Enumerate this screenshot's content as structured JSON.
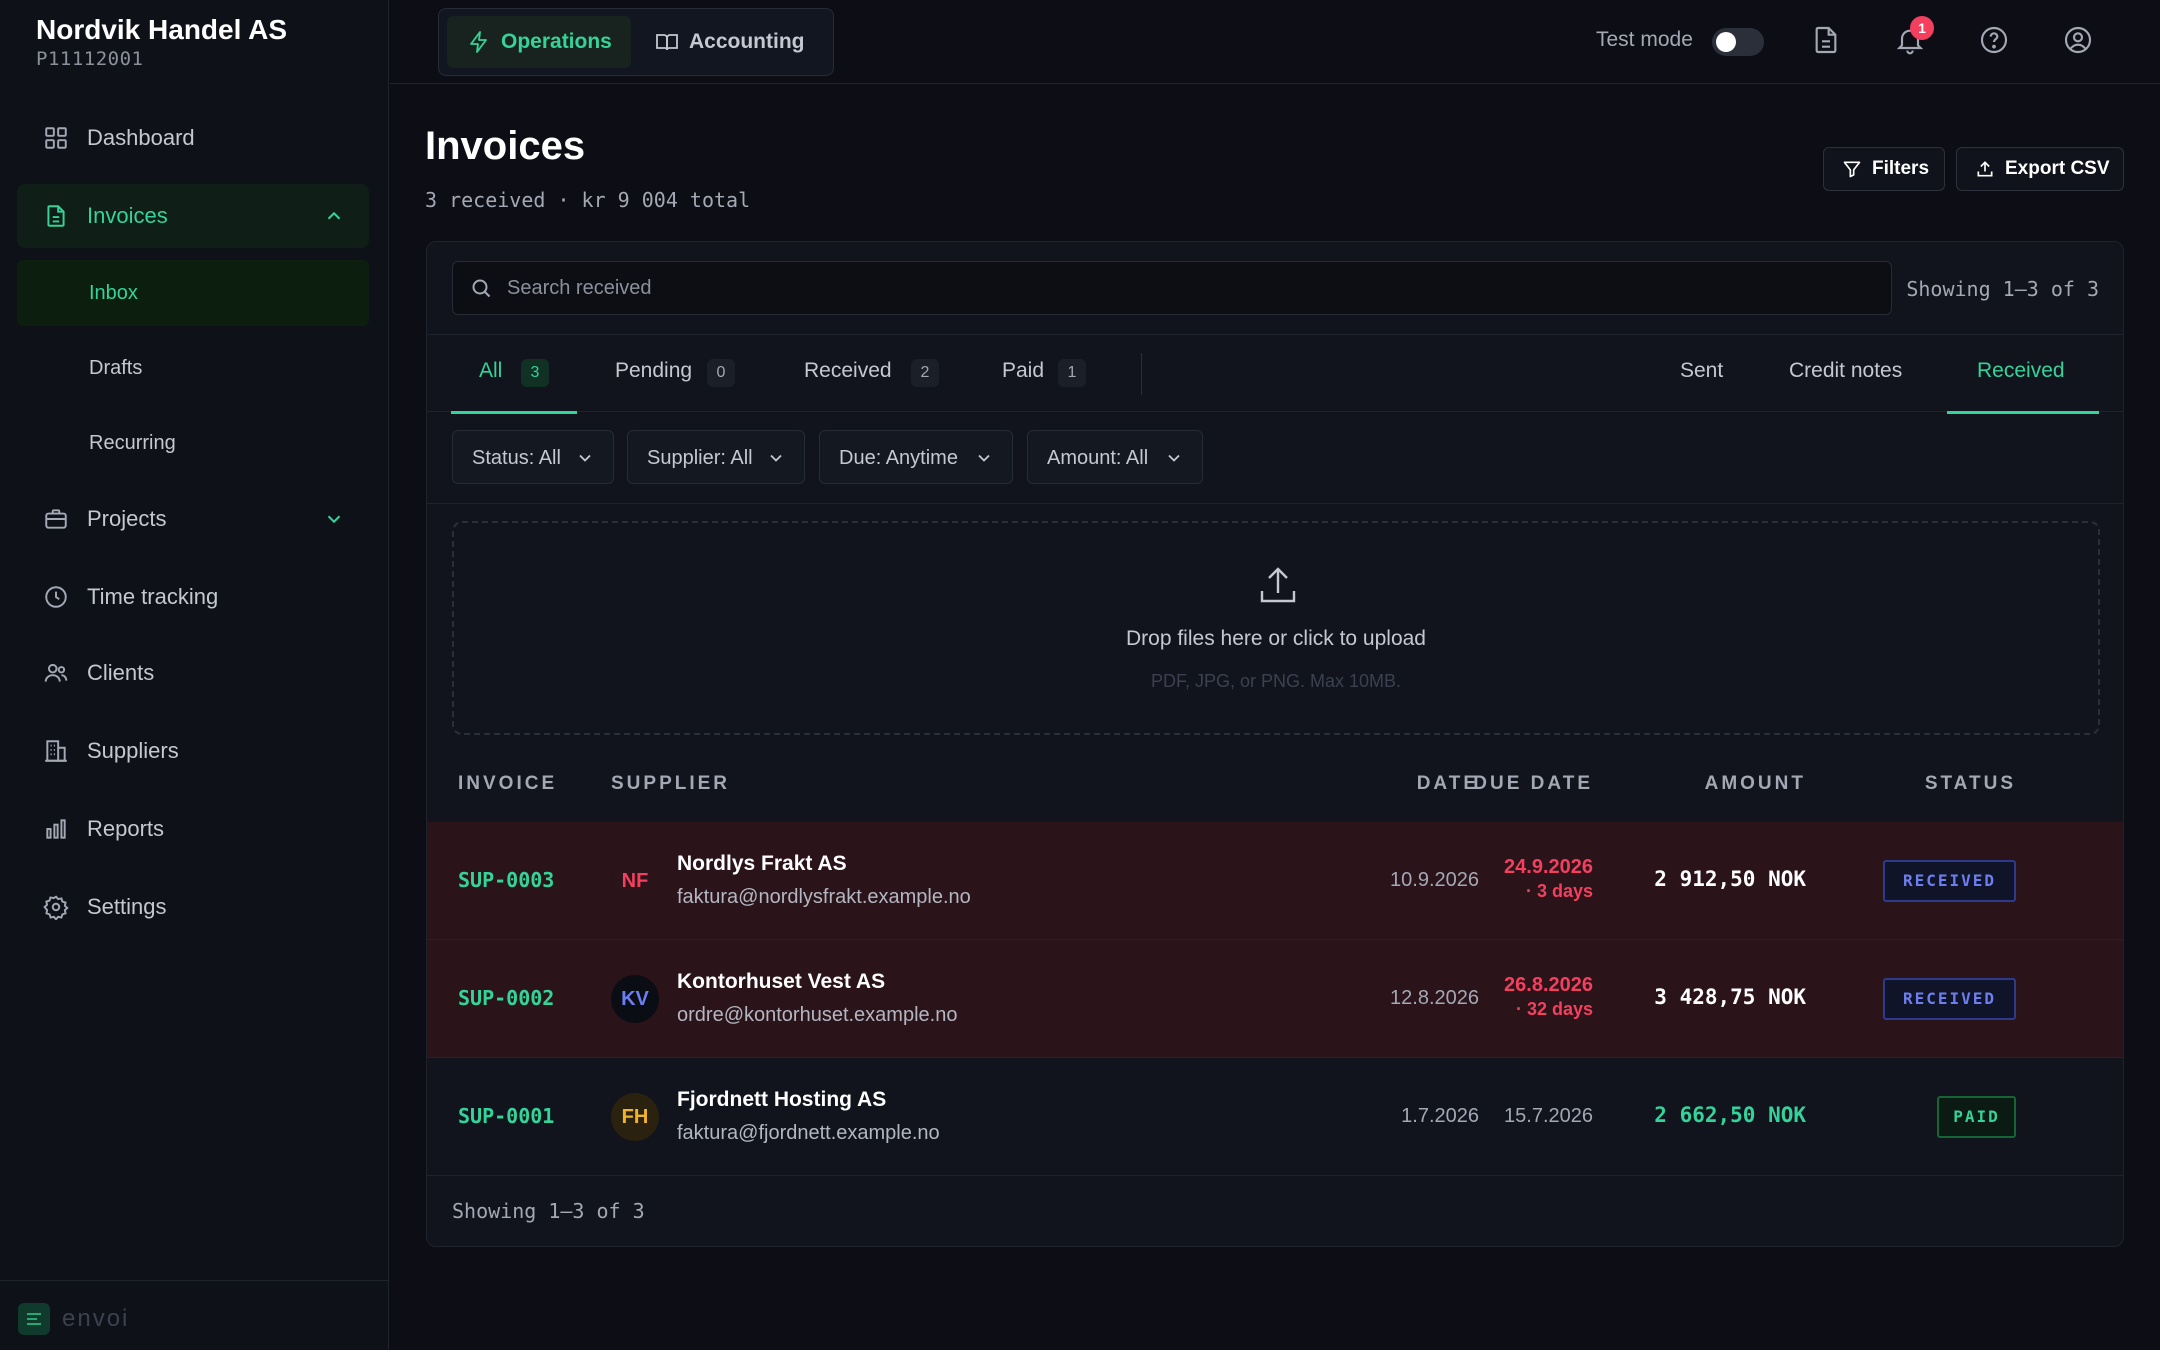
{
  "org": {
    "name": "Nordvik Handel AS",
    "id": "P11112001"
  },
  "nav": {
    "dashboard": "Dashboard",
    "invoices": "Invoices",
    "inbox": "Inbox",
    "drafts": "Drafts",
    "recurring": "Recurring",
    "projects": "Projects",
    "time_tracking": "Time tracking",
    "clients": "Clients",
    "suppliers": "Suppliers",
    "reports": "Reports",
    "settings": "Settings"
  },
  "brand": "envoi",
  "topbar": {
    "operations": "Operations",
    "accounting": "Accounting",
    "test_mode": "Test mode",
    "notification_count": "1"
  },
  "page": {
    "title": "Invoices",
    "subtitle": "3 received · kr 9 004 total",
    "filters_btn": "Filters",
    "export_btn": "Export CSV"
  },
  "search": {
    "placeholder": "Search received",
    "showing": "Showing 1–3 of 3"
  },
  "tabs": {
    "all": "All",
    "all_count": "3",
    "pending": "Pending",
    "pending_count": "0",
    "received": "Received",
    "received_count": "2",
    "paid": "Paid",
    "paid_count": "1",
    "sent": "Sent",
    "credit_notes": "Credit notes",
    "received_view": "Received"
  },
  "filters": {
    "status": "Status: All",
    "supplier": "Supplier: All",
    "due": "Due: Anytime",
    "amount": "Amount: All"
  },
  "upload": {
    "title": "Drop files here or click to upload",
    "hint": "PDF, JPG, or PNG. Max 10MB."
  },
  "table": {
    "headers": {
      "invoice": "INVOICE",
      "supplier": "SUPPLIER",
      "date": "DATE",
      "due_date": "DUE DATE",
      "amount": "AMOUNT",
      "status": "STATUS"
    },
    "rows": [
      {
        "id": "SUP-0003",
        "initials": "NF",
        "name": "Nordlys Frakt AS",
        "email": "faktura@nordlysfrakt.example.no",
        "date": "10.9.2026",
        "due": "24.9.2026",
        "due_note": "· 3 days",
        "amount": "2 912,50 NOK",
        "status": "RECEIVED"
      },
      {
        "id": "SUP-0002",
        "initials": "KV",
        "name": "Kontorhuset Vest AS",
        "email": "ordre@kontorhuset.example.no",
        "date": "12.8.2026",
        "due": "26.8.2026",
        "due_note": "· 32 days",
        "amount": "3 428,75 NOK",
        "status": "RECEIVED"
      },
      {
        "id": "SUP-0001",
        "initials": "FH",
        "name": "Fjordnett Hosting AS",
        "email": "faktura@fjordnett.example.no",
        "date": "1.7.2026",
        "due": "15.7.2026",
        "amount": "2 662,50 NOK",
        "status": "PAID"
      }
    ]
  },
  "footer": {
    "showing": "Showing 1–3 of 3"
  },
  "colors": {
    "accent": "#34d399",
    "danger": "#f43f5e",
    "received": "#6d7ff0",
    "background": "#0d0e15"
  }
}
